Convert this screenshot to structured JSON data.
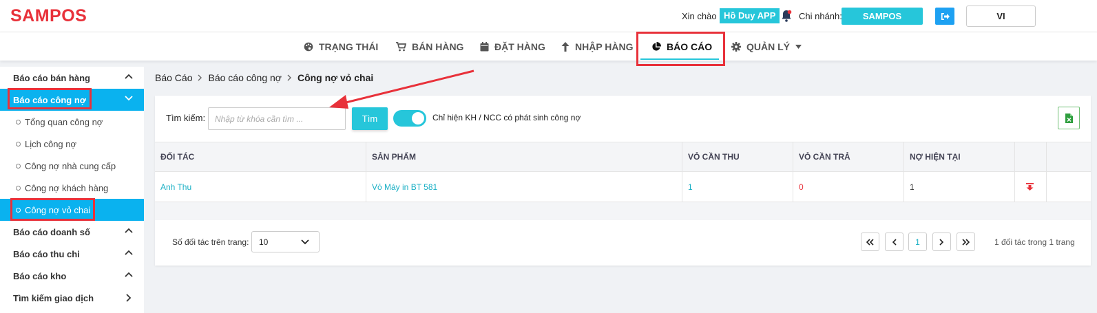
{
  "header": {
    "logo": "SAMPOS",
    "greeting": "Xin chào",
    "user_name": "Hồ Duy APP",
    "branch_label": "Chi nhánh:",
    "branch_name": "SAMPOS",
    "language": "VI"
  },
  "nav": {
    "items": [
      {
        "label": "TRẠNG THÁI",
        "icon": "palette-icon"
      },
      {
        "label": "BÁN HÀNG",
        "icon": "cart-icon"
      },
      {
        "label": "ĐẶT HÀNG",
        "icon": "calendar-icon"
      },
      {
        "label": "NHẬP HÀNG",
        "icon": "arrow-up-icon"
      },
      {
        "label": "BÁO CÁO",
        "icon": "pie-chart-icon",
        "active": true
      },
      {
        "label": "QUẢN LÝ",
        "icon": "gear-icon",
        "dropdown": true
      }
    ]
  },
  "sidebar": {
    "groups": [
      {
        "label": "Báo cáo bán hàng"
      },
      {
        "label": "Báo cáo công nợ",
        "active": true
      },
      {
        "label": "Báo cáo doanh số"
      },
      {
        "label": "Báo cáo thu chi"
      },
      {
        "label": "Báo cáo kho"
      },
      {
        "label": "Tìm kiếm giao dịch"
      }
    ],
    "sub_items": [
      {
        "label": "Tổng quan công nợ"
      },
      {
        "label": "Lịch công nợ"
      },
      {
        "label": "Công nợ nhà cung cấp"
      },
      {
        "label": "Công nợ khách hàng"
      },
      {
        "label": "Công nợ vỏ chai",
        "active": true
      }
    ]
  },
  "breadcrumb": [
    "Báo Cáo",
    "Báo cáo công nợ",
    "Công nợ vỏ chai"
  ],
  "filters": {
    "search_label": "Tìm kiếm:",
    "search_placeholder": "Nhập từ khóa cần tìm ...",
    "search_button": "Tìm",
    "toggle_label": "Chỉ hiện KH / NCC có phát sinh công nợ",
    "toggle_on": true
  },
  "table": {
    "columns": [
      "ĐỐI TÁC",
      "SẢN PHẨM",
      "VỎ CẦN THU",
      "VỎ CẦN TRẢ",
      "NỢ HIỆN TẠI"
    ],
    "rows": [
      {
        "partner": "Anh Thu",
        "product": "Vỏ Máy in BT 581",
        "to_collect": "1",
        "to_return": "0",
        "current_debt": "1"
      }
    ]
  },
  "pagination": {
    "per_page_label": "Số đối tác trên trang:",
    "per_page_value": "10",
    "current_page": "1",
    "info": "1 đối tác trong 1 trang"
  },
  "colors": {
    "brand": "#e8313a",
    "accent": "#26c6da",
    "sidebar_active": "#0ab2ef"
  }
}
